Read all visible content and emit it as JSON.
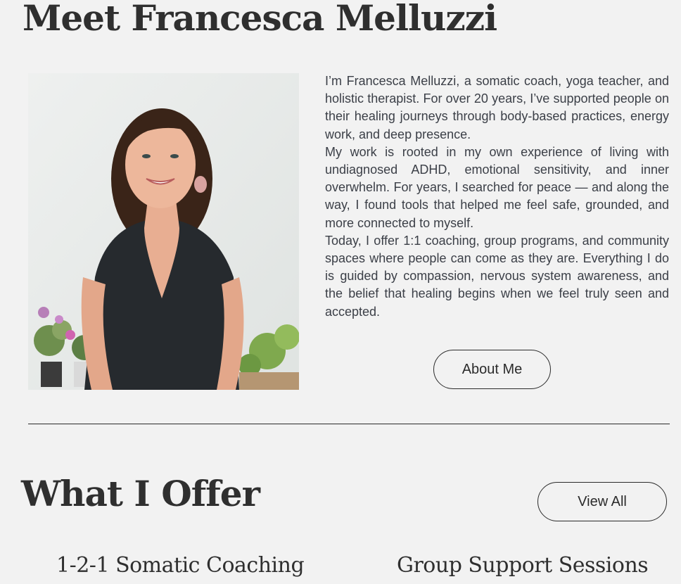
{
  "about": {
    "heading": "Meet Francesca Melluzzi",
    "photo_alt": "Portrait of Francesca Melluzzi",
    "paragraphs": [
      "I’m Francesca Melluzzi, a somatic coach, yoga teacher, and holistic therapist. For over 20 years, I’ve supported people on their healing journeys through body-based practices, energy work, and deep presence.",
      "My work is rooted in my own experience of living with undiagnosed ADHD, emotional sensitivity, and inner overwhelm. For years, I searched for peace — and along the way, I found tools that helped me feel safe, grounded, and more connected to myself.",
      "Today, I offer 1:1 coaching, group programs, and community spaces where people can come as they are. Everything I do is guided by compassion, nervous system awareness, and the belief that healing begins when we feel truly seen and accepted."
    ],
    "button_label": "About Me"
  },
  "offer": {
    "heading": "What I Offer",
    "view_all_label": "View All",
    "cards": [
      {
        "title": "1-2-1 Somatic Coaching"
      },
      {
        "title": "Group Support Sessions"
      }
    ]
  },
  "colors": {
    "background": "#f2f2f2",
    "text": "#2b2b2b",
    "body_text": "#3b3f47"
  }
}
